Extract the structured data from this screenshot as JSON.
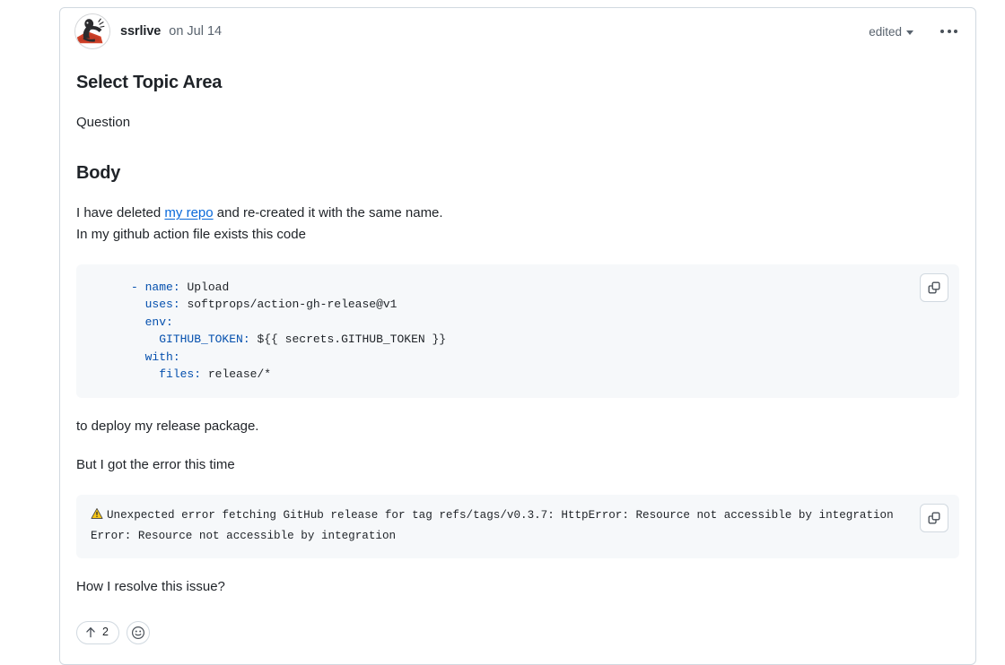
{
  "comment": {
    "author": "ssrlive",
    "timestamp": "on Jul 14",
    "edited_label": "edited",
    "avatar_alt": "ssrlive avatar"
  },
  "sections": {
    "topic_heading": "Select Topic Area",
    "topic_value": "Question",
    "body_heading": "Body"
  },
  "body": {
    "line1_before_link": "I have deleted ",
    "link_text": "my repo",
    "line1_after_link": " and re-created it with the same name.",
    "line2": "In my github action file exists this code",
    "after_code": "to deploy my release package.",
    "before_error": "But I got the error this time",
    "closing_question": "How I resolve this issue?"
  },
  "code_block": {
    "language": "yaml",
    "lines": [
      {
        "indent": 0,
        "parts": [
          {
            "t": "- ",
            "c": "dash"
          },
          {
            "t": "name",
            "c": "key"
          },
          {
            "t": ":",
            "c": "punct"
          },
          {
            "t": " Upload",
            "c": "plain"
          }
        ]
      },
      {
        "indent": 0,
        "parts": [
          {
            "t": "  ",
            "c": "plain"
          },
          {
            "t": "uses",
            "c": "key"
          },
          {
            "t": ":",
            "c": "punct"
          },
          {
            "t": " softprops/action-gh-release@v1",
            "c": "plain"
          }
        ]
      },
      {
        "indent": 0,
        "parts": [
          {
            "t": "  ",
            "c": "plain"
          },
          {
            "t": "env",
            "c": "key"
          },
          {
            "t": ":",
            "c": "punct"
          }
        ]
      },
      {
        "indent": 0,
        "parts": [
          {
            "t": "    ",
            "c": "plain"
          },
          {
            "t": "GITHUB_TOKEN",
            "c": "key"
          },
          {
            "t": ":",
            "c": "punct"
          },
          {
            "t": " ${{ secrets.GITHUB_TOKEN }}",
            "c": "plain"
          }
        ]
      },
      {
        "indent": 0,
        "parts": [
          {
            "t": "  ",
            "c": "plain"
          },
          {
            "t": "with",
            "c": "key"
          },
          {
            "t": ":",
            "c": "punct"
          }
        ]
      },
      {
        "indent": 0,
        "parts": [
          {
            "t": "    ",
            "c": "plain"
          },
          {
            "t": "files",
            "c": "key"
          },
          {
            "t": ":",
            "c": "punct"
          },
          {
            "t": " release/*",
            "c": "plain"
          }
        ]
      }
    ],
    "copy_label": "copy-code"
  },
  "error_block": {
    "warning_icon": "warning-triangle-icon",
    "line1": "Unexpected error fetching GitHub release for tag refs/tags/v0.3.7: HttpError: Resource not accessible by integration",
    "line2": "Error: Resource not accessible by integration",
    "copy_label": "copy-error"
  },
  "reactions": {
    "upvote_icon": "arrow-up-icon",
    "upvote_count": "2",
    "add_reaction_icon": "smiley-icon"
  },
  "colors": {
    "link": "#0969da",
    "code_key": "#0550ae",
    "code_bg": "#f6f8fa",
    "border": "#d1d9e0",
    "muted_text": "#59636e",
    "text": "#1f2328"
  }
}
